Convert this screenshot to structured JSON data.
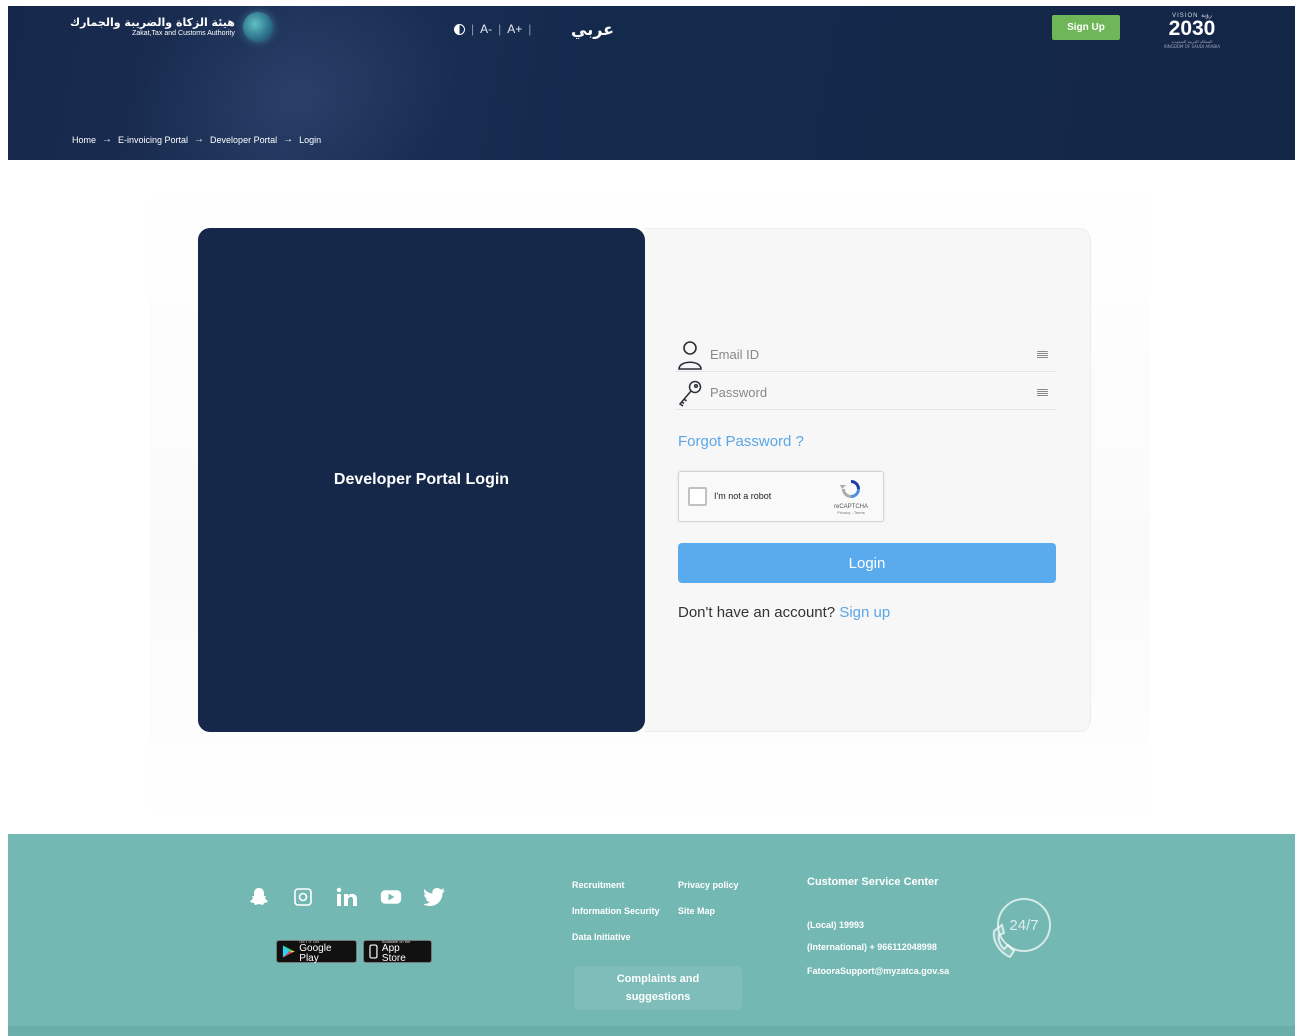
{
  "header": {
    "logo_ar": "هيئة الزكاة والضريبة والجمارك",
    "logo_en": "Zakat,Tax and Customs Authority",
    "a11y": {
      "font_decrease": "A-",
      "font_increase": "A+",
      "sep": "|"
    },
    "language_toggle": "عربي",
    "signup_label": "Sign Up",
    "vision": {
      "top": "VISION رؤية",
      "number": "2030",
      "bottom": "المملكة العربية السعودية KINGDOM OF SAUDI ARABIA"
    },
    "breadcrumb": [
      "Home",
      "E-invoicing Portal",
      "Developer Portal",
      "Login"
    ],
    "breadcrumb_arrow": "→"
  },
  "login": {
    "panel_title": "Developer Portal Login",
    "email_placeholder": "Email ID",
    "password_placeholder": "Password",
    "forgot_password": "Forgot Password ?",
    "captcha_label": "I'm not a robot",
    "captcha_brand": "reCAPTCHA",
    "captcha_links": "Privacy - Terms",
    "login_button": "Login",
    "no_account_text": "Don't have an account?",
    "signup_link": "Sign up"
  },
  "footer": {
    "social": [
      "snapchat-icon",
      "instagram-icon",
      "linkedin-icon",
      "youtube-icon",
      "twitter-icon"
    ],
    "stores": {
      "google_small": "GET IT ON",
      "google_big": "Google Play",
      "apple_small": "Available on the",
      "apple_big": "App Store"
    },
    "links": {
      "recruitment": "Recruitment",
      "privacy": "Privacy policy",
      "infosec": "Information Security",
      "sitemap": "Site Map",
      "data": "Data Initiative"
    },
    "complaints_line1": "Complaints and",
    "complaints_line2": "suggestions",
    "csc": {
      "title": "Customer Service Center",
      "local": "(Local) 19993",
      "international": "(International) + 966112048998",
      "email": "FatooraSupport@myzatca.gov.sa"
    },
    "badge": "24/7"
  },
  "colors": {
    "header_bg": "#16284a",
    "signup_green": "#6fb659",
    "left_panel": "#152849",
    "link_blue": "#5aa6e6",
    "login_btn": "#5aaaee",
    "footer_teal": "#74b8b3"
  }
}
